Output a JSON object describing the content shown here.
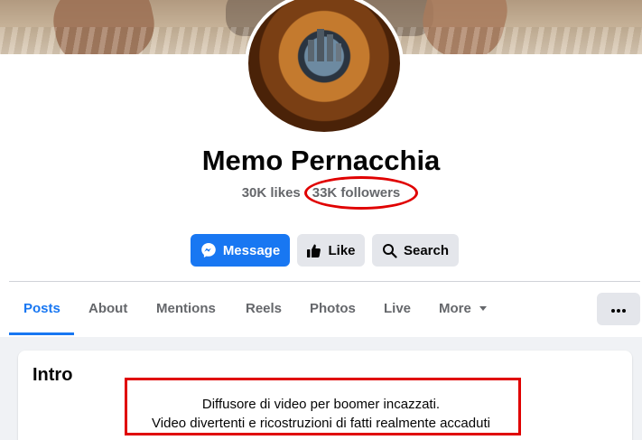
{
  "profile": {
    "name": "Memo Pernacchia",
    "likes": "30K likes",
    "separator": "·",
    "followers": "33K followers"
  },
  "actions": {
    "message_label": "Message",
    "like_label": "Like",
    "search_label": "Search"
  },
  "tabs": [
    {
      "label": "Posts",
      "active": true
    },
    {
      "label": "About",
      "active": false
    },
    {
      "label": "Mentions",
      "active": false
    },
    {
      "label": "Reels",
      "active": false
    },
    {
      "label": "Photos",
      "active": false
    },
    {
      "label": "Live",
      "active": false
    },
    {
      "label": "More",
      "active": false
    }
  ],
  "intro": {
    "title": "Intro",
    "bio_line_1": "Diffusore di video per boomer incazzati.",
    "bio_line_2": "Video divertenti e ricostruzioni di fatti realmente accaduti"
  },
  "icons": {
    "message": "messenger-icon",
    "like": "thumbs-up-icon",
    "search": "search-icon",
    "more": "caret-down-icon",
    "options": "more-options-icon"
  },
  "colors": {
    "accent": "#1877f2",
    "annotation": "#e00000",
    "secondary_button": "#e4e6eb",
    "feed_background": "#f0f2f5"
  }
}
